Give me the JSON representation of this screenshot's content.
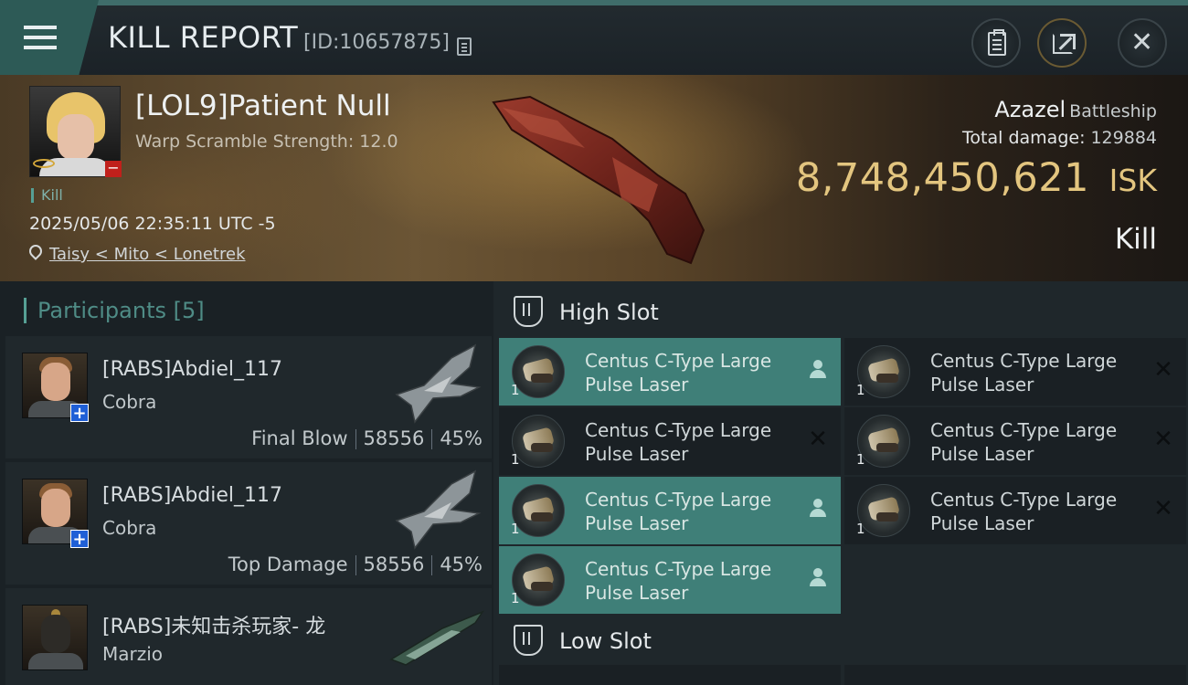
{
  "header": {
    "title": "KILL REPORT",
    "report_id": "[ID:10657875]",
    "icons": [
      "menu-icon",
      "copy-icon",
      "clipboard-icon",
      "share-icon",
      "close-icon"
    ],
    "close_glyph": "✕"
  },
  "victim": {
    "name": "[LOL9]Patient Null",
    "warp_scramble": "Warp Scramble Strength: 12.0",
    "kill_tag": "Kill",
    "timestamp": "2025/05/06 22:35:11 UTC -5",
    "location": "Taisy < Mito < Lonetrek",
    "ship_name": "Azazel",
    "ship_class": "Battleship",
    "total_damage_label": "Total damage:",
    "total_damage": "129884",
    "isk_value": "8,748,450,621",
    "isk_unit": "ISK",
    "result": "Kill",
    "minus_badge": "−"
  },
  "participants": {
    "header": "Participants [5]",
    "plus_badge": "+",
    "items": [
      {
        "name": "[RABS]Abdiel_117",
        "ship": "Cobra",
        "role": "Final Blow",
        "damage": "58556",
        "percent": "45%"
      },
      {
        "name": "[RABS]Abdiel_117",
        "ship": "Cobra",
        "role": "Top Damage",
        "damage": "58556",
        "percent": "45%"
      },
      {
        "name": "[RABS]未知击杀玩家- 龙",
        "ship": "Marzio",
        "role": "",
        "damage": "",
        "percent": ""
      }
    ]
  },
  "slots": {
    "high_slot_label": "High Slot",
    "low_slot_label": "Low Slot",
    "high_slot_modules": [
      {
        "name": "Centus C-Type Large Pulse Laser",
        "qty": "1",
        "status": "dropped"
      },
      {
        "name": "Centus C-Type Large Pulse Laser",
        "qty": "1",
        "status": "destroyed"
      },
      {
        "name": "Centus C-Type Large Pulse Laser",
        "qty": "1",
        "status": "destroyed"
      },
      {
        "name": "Centus C-Type Large Pulse Laser",
        "qty": "1",
        "status": "destroyed"
      },
      {
        "name": "Centus C-Type Large Pulse Laser",
        "qty": "1",
        "status": "dropped"
      },
      {
        "name": "Centus C-Type Large Pulse Laser",
        "qty": "1",
        "status": "destroyed"
      },
      {
        "name": "Centus C-Type Large Pulse Laser",
        "qty": "1",
        "status": "dropped"
      }
    ],
    "destroyed_glyph": "✕"
  },
  "colors": {
    "accent": "#56a095",
    "dropped_row": "#3f7f78",
    "isk_gold": "#e3c57f",
    "minus_badge": "#c0201b",
    "plus_badge": "#1f5fd6"
  }
}
